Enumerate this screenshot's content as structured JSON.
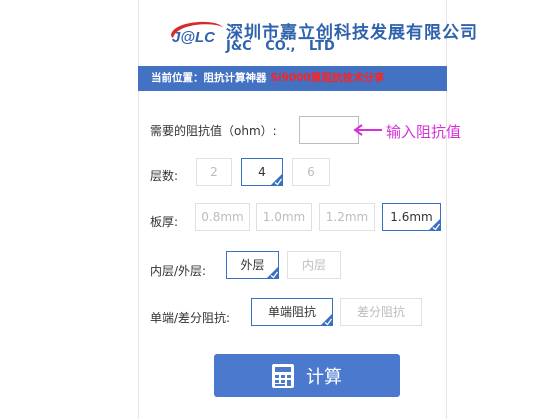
{
  "logo": {
    "text": "J@LC"
  },
  "company": {
    "name_cn": "深圳市嘉立创科技发展有限公司",
    "name_en": "J&C CO., LTD"
  },
  "breadcrumb": {
    "label": "当前位置：",
    "current": "阻抗计算神器",
    "highlight": "Si9000算阻抗技术分享"
  },
  "impedance": {
    "label": "需要的阻抗值（ohm）:",
    "value": "",
    "hint": "输入阻抗值"
  },
  "layers": {
    "label": "层数:",
    "options": [
      "2",
      "4",
      "6"
    ],
    "selected": "4"
  },
  "thickness": {
    "label": "板厚:",
    "options": [
      "0.8mm",
      "1.0mm",
      "1.2mm",
      "1.6mm"
    ],
    "selected": "1.6mm"
  },
  "layer_side": {
    "label": "内层/外层:",
    "options": [
      "外层",
      "内层"
    ],
    "selected": "外层"
  },
  "impedance_type": {
    "label": "单端/差分阻抗:",
    "options": [
      "单端阻抗",
      "差分阻抗"
    ],
    "selected": "单端阻抗"
  },
  "calculate": {
    "label": "计算"
  },
  "colors": {
    "brand_blue": "#2f63ad",
    "bar_blue": "#4272c1",
    "button_blue": "#4a79cd",
    "hint_magenta": "#d630d6",
    "highlight_red": "#ff2222"
  }
}
